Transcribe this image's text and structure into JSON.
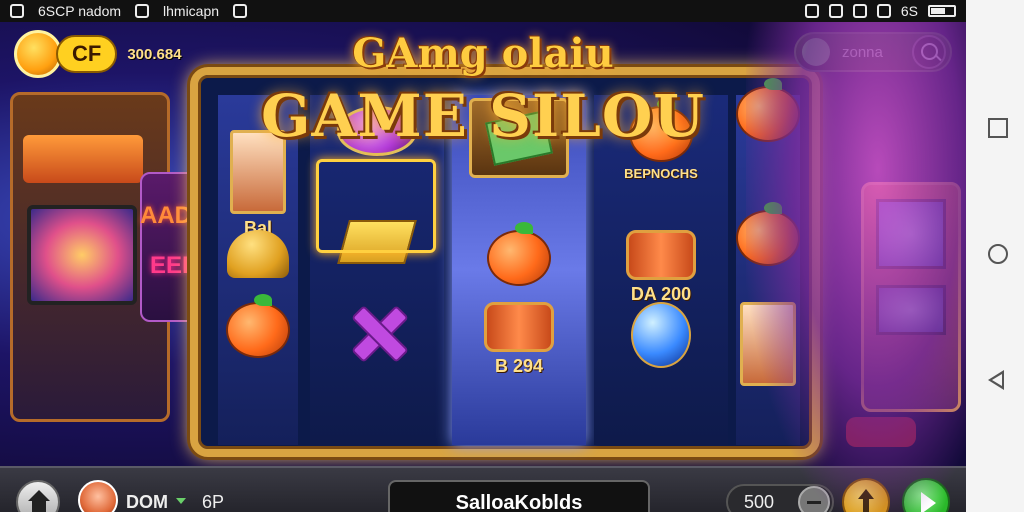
{
  "status_bar": {
    "left_text_1": "6SCP nadom",
    "left_text_2": "lhmicapn",
    "right_text": "6S"
  },
  "game": {
    "title_top": "GAmg olaiu",
    "title_main": "GAME SILOU",
    "background_signs": [
      "AADGSCI",
      "EEP"
    ],
    "currency_code": "CF",
    "balance": "300.684",
    "top_right_label": "zonna",
    "reels": [
      {
        "symbols": [
          {
            "type": "card",
            "label": "Bal"
          },
          {
            "type": "bell",
            "label": ""
          },
          {
            "type": "fruit",
            "label": ""
          }
        ]
      },
      {
        "symbols": [
          {
            "type": "gem-purple",
            "label": ""
          },
          {
            "type": "ticket",
            "label": ""
          },
          {
            "type": "cross",
            "label": ""
          }
        ]
      },
      {
        "symbols": [
          {
            "type": "chest",
            "label": ""
          },
          {
            "type": "fruit",
            "label": ""
          },
          {
            "type": "barrel",
            "label": "B 294"
          }
        ]
      },
      {
        "symbols": [
          {
            "type": "fruit",
            "label": "BEPNOCHS"
          },
          {
            "type": "barrel",
            "label": "DA 200"
          },
          {
            "type": "gem-blue",
            "label": ""
          }
        ]
      },
      {
        "symbols": [
          {
            "type": "fruit",
            "label": ""
          },
          {
            "type": "fruit",
            "label": ""
          },
          {
            "type": "card",
            "label": ""
          }
        ]
      }
    ]
  },
  "bottom_bar": {
    "bet_value": "DOM",
    "bet_unit": "6P",
    "main_button_label": "SalloaKoblds",
    "credit_value": "500"
  },
  "colors": {
    "gold": "#d9a441",
    "accent_green": "#2ab82a",
    "accent_yellow": "#ffd020"
  }
}
